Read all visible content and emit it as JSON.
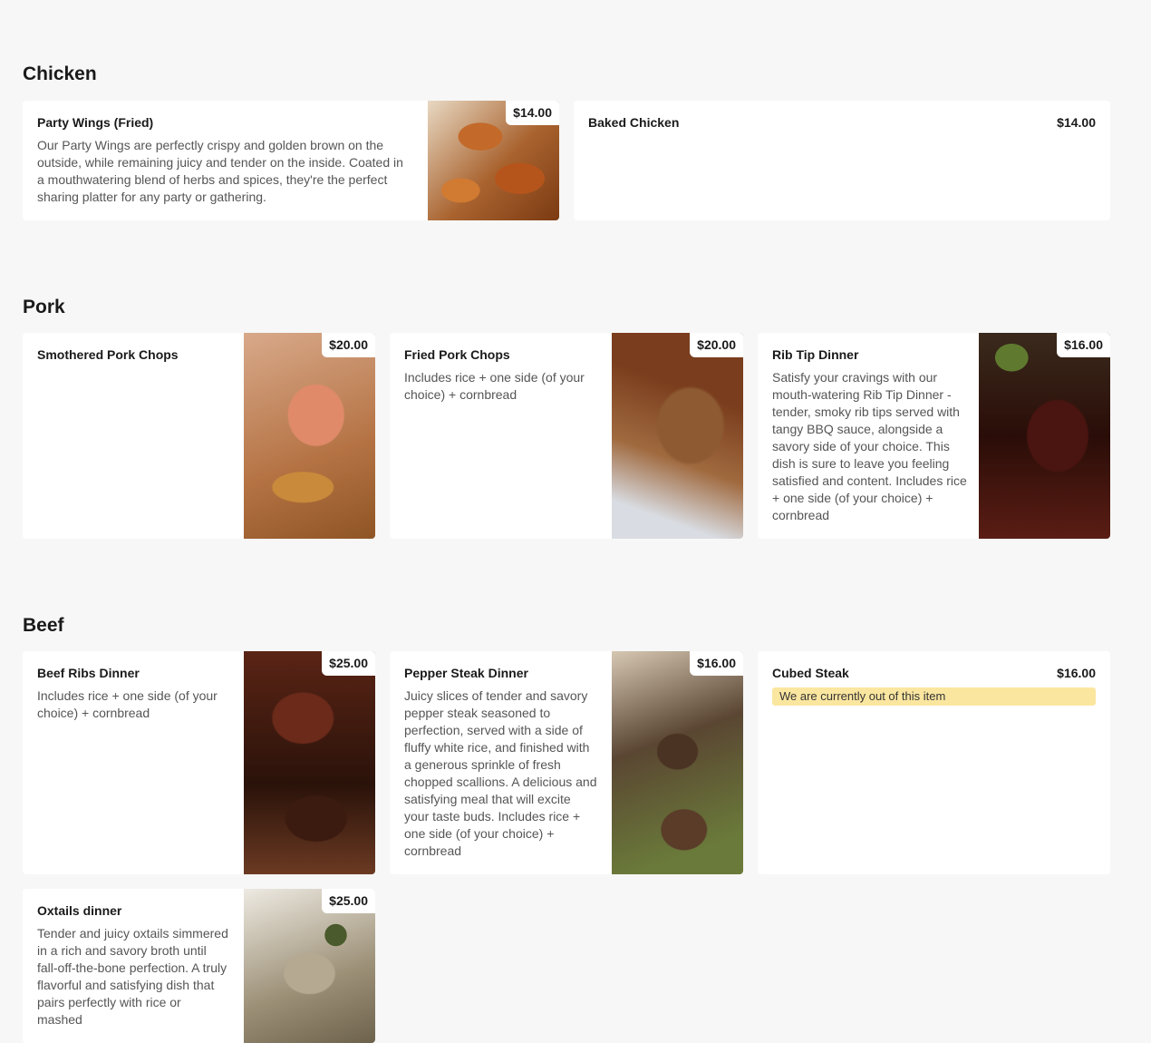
{
  "sections": [
    {
      "title": "Chicken",
      "items": [
        {
          "name": "Party Wings (Fried)",
          "price": "$14.00",
          "description": "Our Party Wings are perfectly crispy and golden brown on the outside, while remaining juicy and tender on the inside. Coated in a mouthwatering blend of herbs and spices, they're the perfect sharing platter for any party or gathering.",
          "photo": "fried-wings-photo"
        },
        {
          "name": "Baked Chicken",
          "price": "$14.00"
        }
      ]
    },
    {
      "title": "Pork",
      "items": [
        {
          "name": "Smothered Pork Chops",
          "price": "$20.00",
          "photo": "smothered-pork-chops-photo"
        },
        {
          "name": "Fried Pork Chops",
          "price": "$20.00",
          "description": "Includes rice + one side (of your choice) + cornbread",
          "photo": "fried-pork-chops-photo"
        },
        {
          "name": "Rib Tip Dinner",
          "price": "$16.00",
          "description": "Satisfy your cravings with our mouth-watering Rib Tip Dinner - tender, smoky rib tips served with tangy BBQ sauce, alongside a savory side of your choice. This dish is sure to leave you feeling satisfied and content. Includes rice + one side (of your choice) + cornbread",
          "photo": "rib-tips-photo"
        }
      ]
    },
    {
      "title": "Beef",
      "items": [
        {
          "name": "Beef Ribs Dinner",
          "price": "$25.00",
          "description": "Includes rice + one side (of your choice) + cornbread",
          "photo": "beef-ribs-photo"
        },
        {
          "name": "Pepper Steak Dinner",
          "price": "$16.00",
          "description": "Juicy slices of tender and savory pepper steak seasoned to perfection, served with a side of fluffy white rice, and finished with a generous sprinkle of fresh chopped scallions. A delicious and satisfying meal that will excite your taste buds. Includes rice + one side (of your choice) + cornbread",
          "photo": "pepper-steak-photo"
        },
        {
          "name": "Cubed Steak",
          "price": "$16.00",
          "notice": "We are currently out of this item"
        },
        {
          "name": "Oxtails dinner",
          "price": "$25.00",
          "description": "Tender and juicy oxtails simmered in a rich and savory broth until fall-off-the-bone perfection. A truly flavorful and satisfying dish that pairs perfectly with rice or mashed",
          "photo": "oxtails-photo"
        }
      ]
    }
  ]
}
